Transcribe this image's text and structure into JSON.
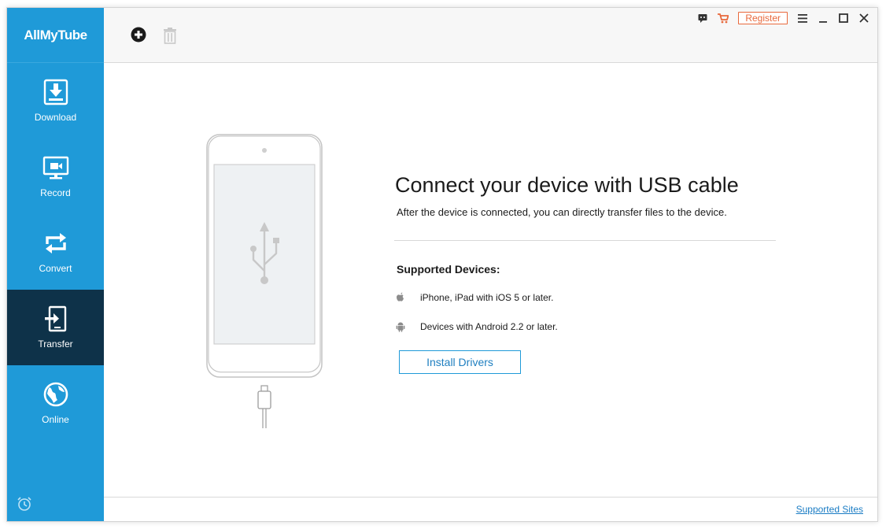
{
  "app": {
    "name": "AllMyTube"
  },
  "colors": {
    "sidebar": "#1f9ad8",
    "sidebar_active": "#0e3249",
    "accent": "#1f9ad8",
    "register": "#e8693c"
  },
  "sidebar": {
    "items": [
      {
        "label": "Download",
        "icon": "download-icon"
      },
      {
        "label": "Record",
        "icon": "record-icon"
      },
      {
        "label": "Convert",
        "icon": "convert-icon"
      },
      {
        "label": "Transfer",
        "icon": "transfer-icon",
        "active": true
      },
      {
        "label": "Online",
        "icon": "online-icon"
      }
    ],
    "bottom_icon": "alarm-icon"
  },
  "toolbar": {
    "add_icon": "add-icon",
    "delete_icon": "trash-icon"
  },
  "window_controls": {
    "register_label": "Register",
    "icons": [
      "feedback-icon",
      "cart-icon",
      "menu-icon",
      "minimize-icon",
      "maximize-icon",
      "close-icon"
    ]
  },
  "main": {
    "title": "Connect your device with USB cable",
    "subtitle": "After the device is connected, you can directly transfer files to the device.",
    "supported_title": "Supported Devices:",
    "devices": [
      {
        "icon": "apple-icon",
        "text": "iPhone, iPad with iOS 5 or later."
      },
      {
        "icon": "android-icon",
        "text": "Devices with Android 2.2 or later."
      }
    ],
    "install_button": "Install Drivers"
  },
  "footer": {
    "link": "Supported Sites"
  }
}
